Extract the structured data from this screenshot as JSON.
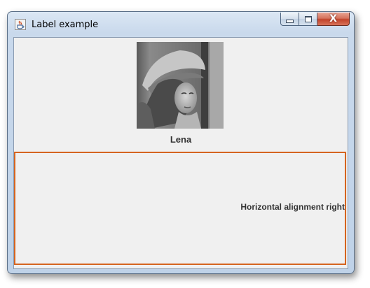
{
  "window": {
    "title": "Label example",
    "icon": "java-cup-icon"
  },
  "caption_buttons": {
    "minimize": "minimize-icon",
    "maximize": "maximize-icon",
    "close": "close-icon",
    "close_glyph": "X"
  },
  "picture_label": {
    "image": "lena-photo",
    "text": "Lena"
  },
  "aligned_label": {
    "text": "Horizontal alignment right",
    "border_color": "#d5641f"
  }
}
